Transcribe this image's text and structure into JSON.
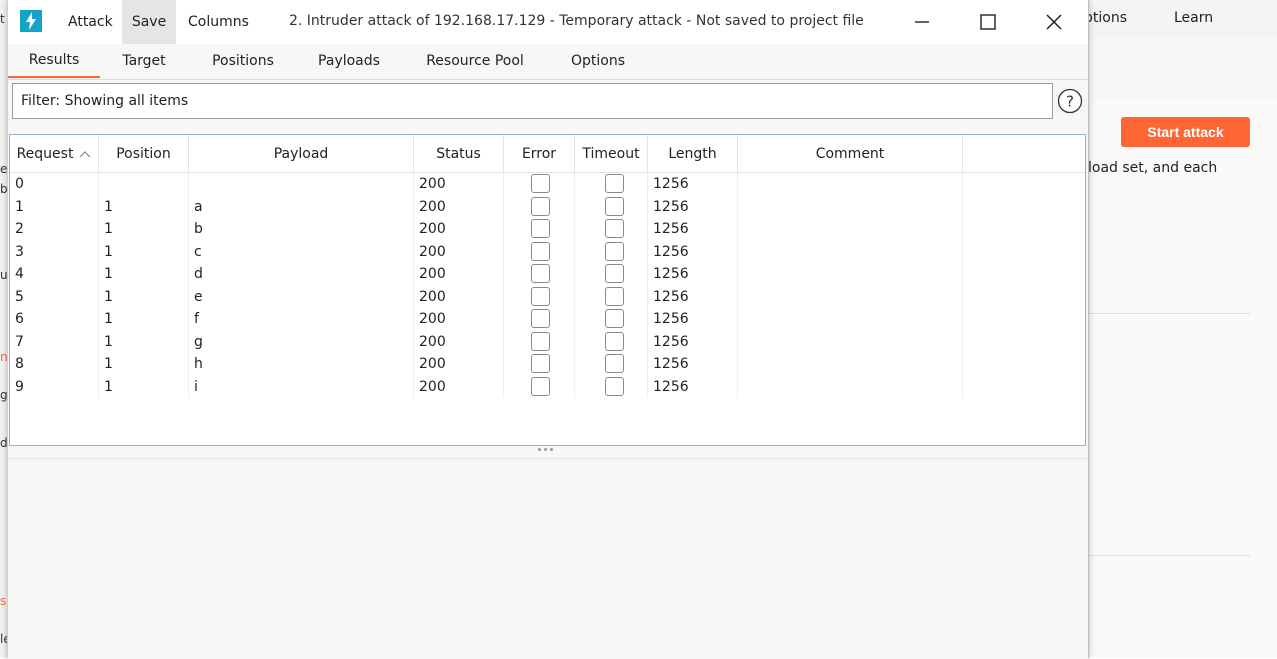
{
  "background": {
    "menu": [
      "ptions",
      "Learn"
    ],
    "start_attack_label": "Start attack",
    "description_fragment": "load set, and each",
    "left_edge_glyphs": [
      "t",
      "e",
      "b",
      "u",
      "n",
      "g",
      "d",
      "s",
      "le"
    ]
  },
  "dialog": {
    "menu": {
      "attack": "Attack",
      "save": "Save",
      "columns": "Columns"
    },
    "title": "2. Intruder attack of 192.168.17.129 - Temporary attack - Not saved to project file",
    "tabs": [
      "Results",
      "Target",
      "Positions",
      "Payloads",
      "Resource Pool",
      "Options"
    ],
    "active_tab": "Results",
    "filter_text": "Filter: Showing all items",
    "columns": [
      "Request",
      "Position",
      "Payload",
      "Status",
      "Error",
      "Timeout",
      "Length",
      "Comment"
    ],
    "sort_column": "Request",
    "rows": [
      {
        "request": "0",
        "position": "",
        "payload": "",
        "status": "200",
        "length": "1256"
      },
      {
        "request": "1",
        "position": "1",
        "payload": "a",
        "status": "200",
        "length": "1256"
      },
      {
        "request": "2",
        "position": "1",
        "payload": "b",
        "status": "200",
        "length": "1256"
      },
      {
        "request": "3",
        "position": "1",
        "payload": "c",
        "status": "200",
        "length": "1256"
      },
      {
        "request": "4",
        "position": "1",
        "payload": "d",
        "status": "200",
        "length": "1256"
      },
      {
        "request": "5",
        "position": "1",
        "payload": "e",
        "status": "200",
        "length": "1256"
      },
      {
        "request": "6",
        "position": "1",
        "payload": "f",
        "status": "200",
        "length": "1256"
      },
      {
        "request": "7",
        "position": "1",
        "payload": "g",
        "status": "200",
        "length": "1256"
      },
      {
        "request": "8",
        "position": "1",
        "payload": "h",
        "status": "200",
        "length": "1256"
      },
      {
        "request": "9",
        "position": "1",
        "payload": "i",
        "status": "200",
        "length": "1256"
      }
    ]
  },
  "colors": {
    "accent": "#ff6633",
    "app_icon": "#14a3c7",
    "table_border": "#8fb3d9"
  }
}
